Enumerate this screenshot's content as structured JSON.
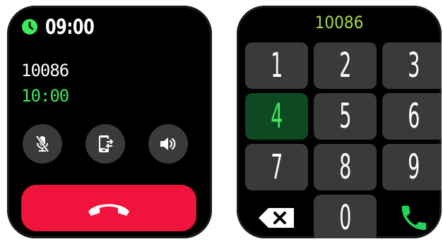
{
  "call_screen": {
    "status_time": "09:00",
    "caller_number": "10086",
    "call_duration": "10:00",
    "controls": [
      "mute-mic-icon",
      "switch-device-icon",
      "speaker-icon"
    ],
    "end_call_icon": "hangup-phone-icon",
    "colors": {
      "end_call": "#f0143c",
      "duration": "#3ee85f",
      "control_bg": "#3a3a3a"
    }
  },
  "dialpad": {
    "dialed_number": "10086",
    "keys": [
      "1",
      "2",
      "3",
      "4",
      "5",
      "6",
      "7",
      "8",
      "9",
      "0"
    ],
    "active_key": "4",
    "icons": {
      "delete": "backspace-icon",
      "call": "call-phone-icon"
    },
    "colors": {
      "dialed_text": "#a6d94a",
      "active_bg": "#0d4a22",
      "active_text": "#3ee85f",
      "call_icon": "#22d35a"
    }
  }
}
